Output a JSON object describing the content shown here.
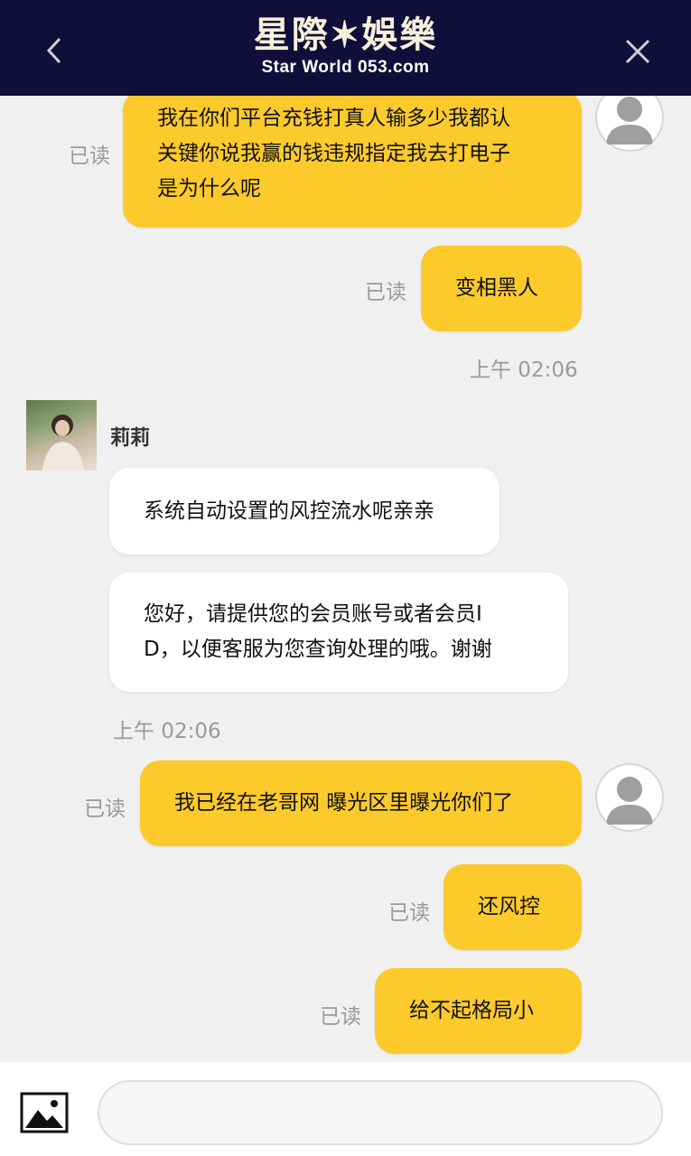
{
  "header": {
    "logo_cn": "星際✶娛樂",
    "logo_en": "Star World 053.com"
  },
  "messages": {
    "m1": {
      "line1": "我在你们平台充钱打真人输多少我都认",
      "line2": "关键你说我赢的钱违规指定我去打电子",
      "line3": "是为什么呢",
      "status": "已读"
    },
    "m2": {
      "text": "变相黑人",
      "status": "已读"
    },
    "time1": "上午 02:06",
    "agent_name": "莉莉",
    "m3": {
      "text": "系统自动设置的风控流水呢亲亲"
    },
    "m4": {
      "line1": "您好，请提供您的会员账号或者会员I",
      "line2": "D，以便客服为您查询处理的哦。谢谢"
    },
    "time2": "上午 02:06",
    "m5": {
      "text": "我已经在老哥网 曝光区里曝光你们了",
      "status": "已读"
    },
    "m6": {
      "text": "还风控",
      "status": "已读"
    },
    "m7": {
      "text": "给不起格局小",
      "status": "已读"
    }
  },
  "composer": {
    "placeholder": ""
  }
}
